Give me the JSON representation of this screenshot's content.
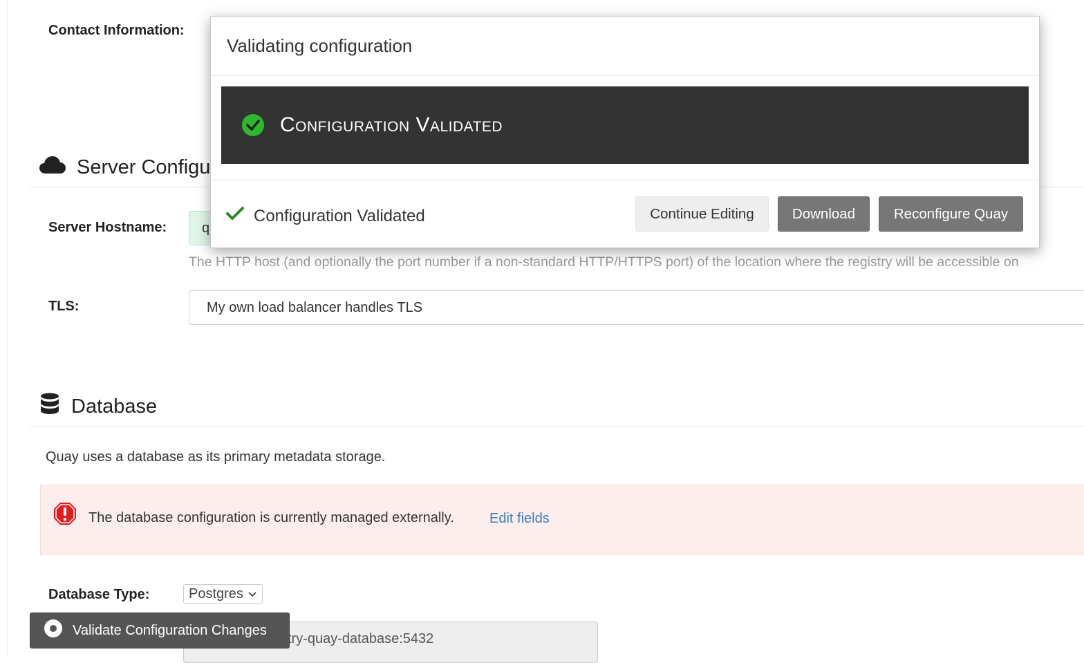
{
  "contact": {
    "label": "Contact Information:"
  },
  "server_section": {
    "title": "Server Configur",
    "hostname_label": "Server Hostname:",
    "hostname_value": "q",
    "hostname_help": "The HTTP host (and optionally the port number if a non-standard HTTP/HTTPS port) of the location where the registry will be accessible on",
    "tls_label": "TLS:",
    "tls_value": "My own load balancer handles TLS"
  },
  "database_section": {
    "title": "Database",
    "description": "Quay uses a database as its primary metadata storage.",
    "alert_text": "The database configuration is currently managed externally.",
    "alert_link": "Edit fields",
    "type_label": "Database Type:",
    "type_value": "Postgres",
    "server_value": "try-quay-database:5432"
  },
  "validate_button": {
    "label": "Validate Configuration Changes"
  },
  "modal": {
    "title": "Validating configuration",
    "banner_text": "Configuration Validated",
    "footer_status": "Configuration Validated",
    "buttons": {
      "continue": "Continue Editing",
      "download": "Download",
      "reconfigure": "Reconfigure Quay"
    }
  },
  "colors": {
    "success_green": "#2eb82e",
    "check_green": "#2b8a2b",
    "danger_red": "#e31c1c",
    "link_blue": "#3a7bbf",
    "banner_dark": "#333333"
  }
}
